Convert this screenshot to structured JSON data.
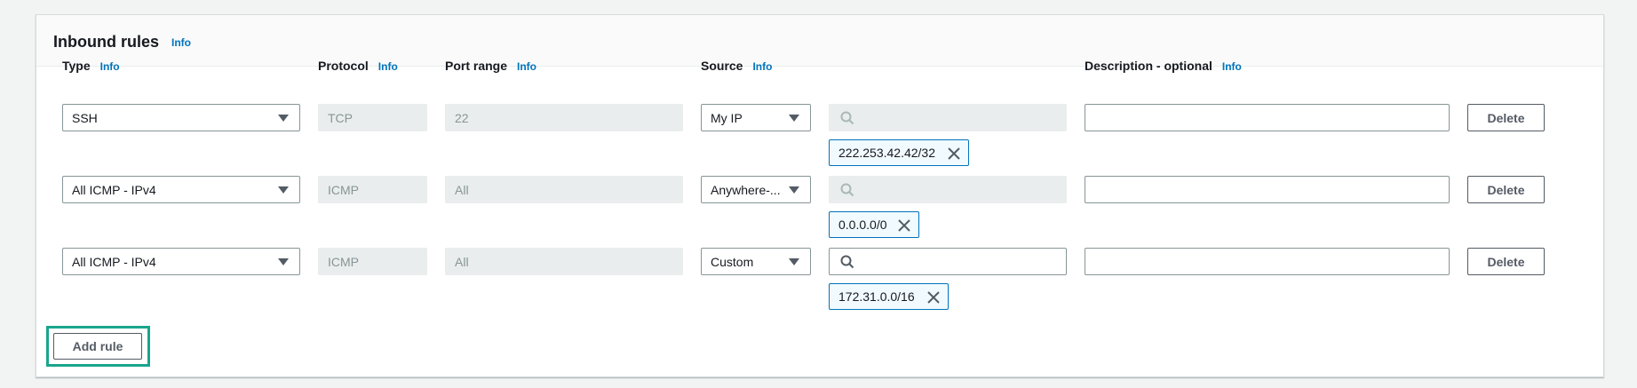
{
  "panel": {
    "title": "Inbound rules",
    "info": "Info"
  },
  "columns": [
    {
      "label": "Type",
      "info": "Info"
    },
    {
      "label": "Protocol",
      "info": "Info"
    },
    {
      "label": "Port range",
      "info": "Info"
    },
    {
      "label": "Source",
      "info": "Info"
    },
    {
      "label": "Description - optional",
      "info": "Info"
    }
  ],
  "rows": [
    {
      "type": "SSH",
      "protocol": "TCP",
      "port_range": "22",
      "source": "My IP",
      "search_value": "",
      "token": "222.253.42.42/32",
      "description": "",
      "delete_label": "Delete"
    },
    {
      "type": "All ICMP - IPv4",
      "protocol": "ICMP",
      "port_range": "All",
      "source": "Anywhere-...",
      "search_value": "",
      "token": "0.0.0.0/0",
      "description": "",
      "delete_label": "Delete"
    },
    {
      "type": "All ICMP - IPv4",
      "protocol": "ICMP",
      "port_range": "All",
      "source": "Custom",
      "search_value": "",
      "token": "172.31.0.0/16",
      "description": "",
      "delete_label": "Delete"
    }
  ],
  "add_rule_label": "Add rule",
  "icons": {
    "search": "search-icon",
    "remove": "close-icon",
    "dropdown": "caret-down-icon"
  },
  "colors": {
    "link": "#0073bb",
    "token_border": "#0073bb",
    "highlight": "#1aa58d"
  }
}
